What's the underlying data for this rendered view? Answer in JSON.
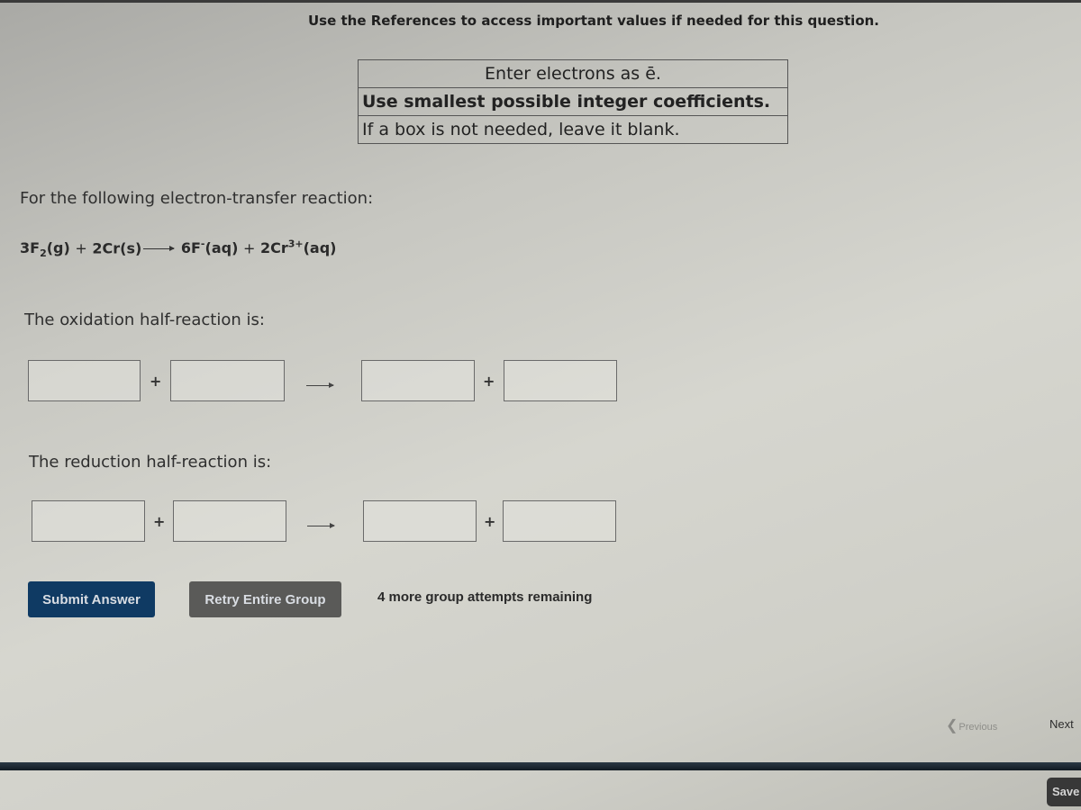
{
  "header": {
    "references_notice": "Use the References to access important values if needed for this question."
  },
  "instructions": [
    "Enter electrons as ē.",
    "Use smallest possible integer coefficients.",
    "If a box is not needed, leave it blank."
  ],
  "question": {
    "prompt": "For the following electron-transfer reaction:",
    "equation": {
      "reactant1_coef": "3F",
      "reactant1_sub": "2",
      "reactant1_state": "(g)",
      "plus": "+",
      "reactant2": "2Cr(s)",
      "product1_coef": "6F",
      "product1_sup": "-",
      "product1_state": "(aq)",
      "product2_coef": "2Cr",
      "product2_sup": "3+",
      "product2_state": "(aq)"
    }
  },
  "oxidation": {
    "label": "The oxidation half-reaction is:",
    "boxes": [
      "",
      "",
      "",
      ""
    ],
    "plus": "+"
  },
  "reduction": {
    "label": "The reduction half-reaction is:",
    "boxes": [
      "",
      "",
      "",
      ""
    ],
    "plus": "+"
  },
  "actions": {
    "submit_label": "Submit Answer",
    "retry_label": "Retry Entire Group",
    "attempts_text": "4 more group attempts remaining"
  },
  "navigation": {
    "previous_label": "Previous",
    "next_label": "Next",
    "save_label": "Save"
  }
}
